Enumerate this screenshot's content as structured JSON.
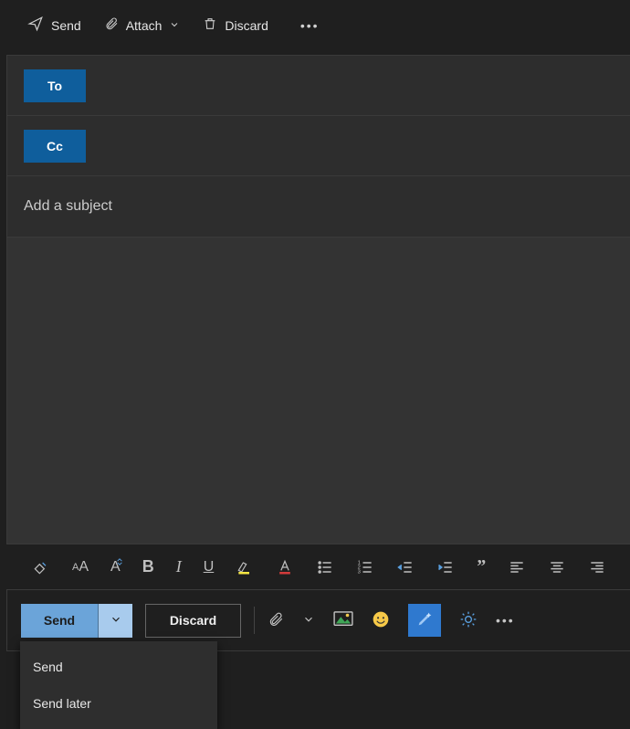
{
  "colors": {
    "accent": "#0f5e9c",
    "send_button": "#6ba4d9",
    "send_chevron": "#a8cbed",
    "ai_highlight": "#2f79cf"
  },
  "top_toolbar": {
    "send_label": "Send",
    "attach_label": "Attach",
    "discard_label": "Discard"
  },
  "recipients": {
    "to_label": "To",
    "cc_label": "Cc"
  },
  "subject": {
    "placeholder": "Add a subject",
    "value": ""
  },
  "body": {
    "value": ""
  },
  "format_bar": {
    "icons": [
      "format-painter",
      "font-size",
      "font-style-case",
      "bold",
      "italic",
      "underline",
      "highlight",
      "font-color",
      "bullets",
      "numbering",
      "indent-decrease",
      "indent-increase",
      "quotation",
      "align-left",
      "align-center",
      "align-right"
    ]
  },
  "action_bar": {
    "send_label": "Send",
    "discard_label": "Discard"
  },
  "send_menu": {
    "item0": "Send",
    "item1": "Send later"
  }
}
